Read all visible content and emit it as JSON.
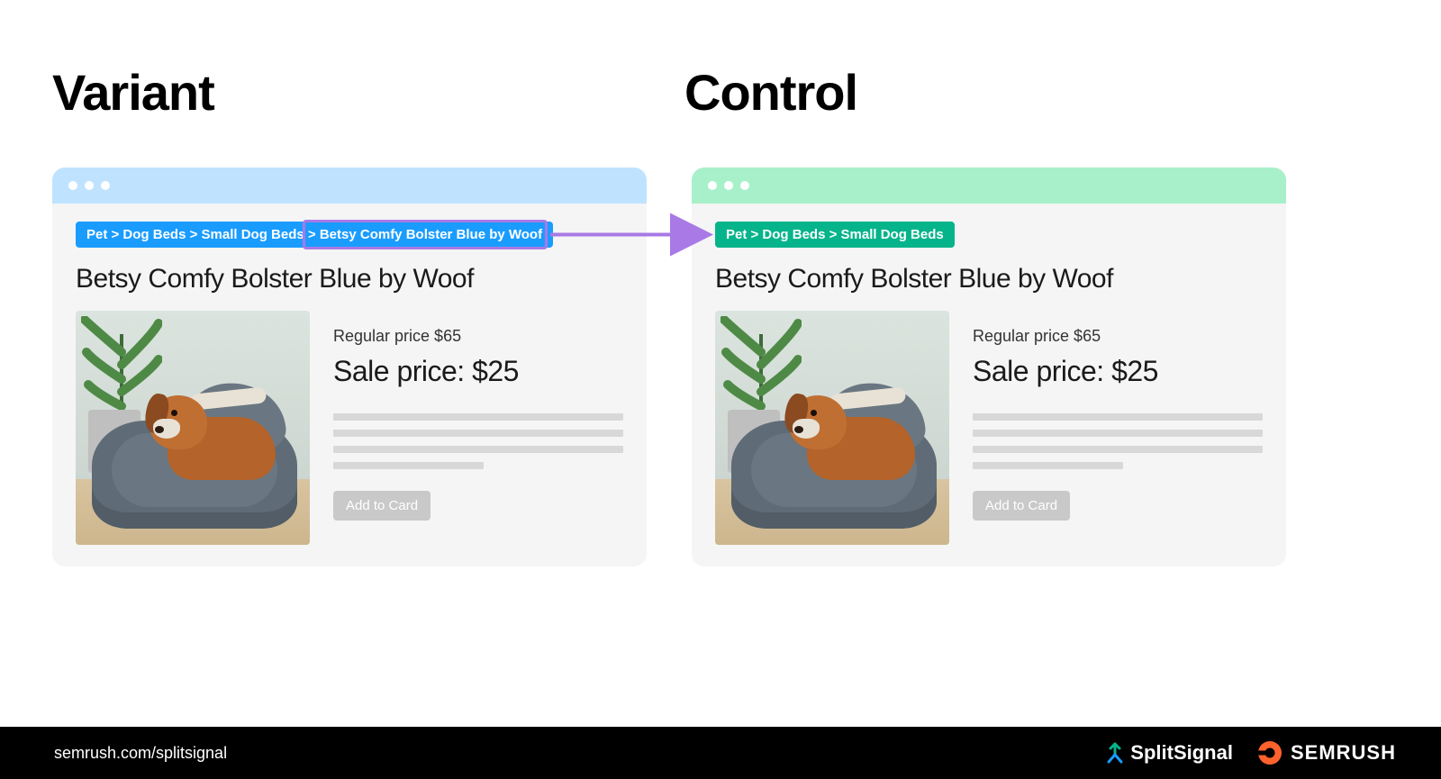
{
  "labels": {
    "variant": "Variant",
    "control": "Control"
  },
  "variant": {
    "breadcrumb_prefix": "Pet > Dog Beds > Small Dog Beds ",
    "breadcrumb_highlight": "> Betsy Comfy Bolster Blue by Woof",
    "title": "Betsy Comfy Bolster Blue by Woof",
    "regular": "Regular price $65",
    "sale": "Sale price: $25",
    "button": "Add to Card",
    "bar_color": "#bfe3ff"
  },
  "control": {
    "breadcrumb": "Pet > Dog Beds > Small Dog Beds",
    "title": "Betsy Comfy Bolster Blue by Woof",
    "regular": "Regular price $65",
    "sale": "Sale price: $25",
    "button": "Add to Card",
    "bar_color": "#a8f0c9"
  },
  "footer": {
    "url": "semrush.com/splitsignal",
    "brand1": "SplitSignal",
    "brand2": "SEMRUSH"
  },
  "colors": {
    "highlight": "#a979e6",
    "arrow": "#a979e6",
    "bc_blue": "#1a9cff",
    "bc_green": "#06b48b",
    "semrush_orange": "#ff622d"
  }
}
